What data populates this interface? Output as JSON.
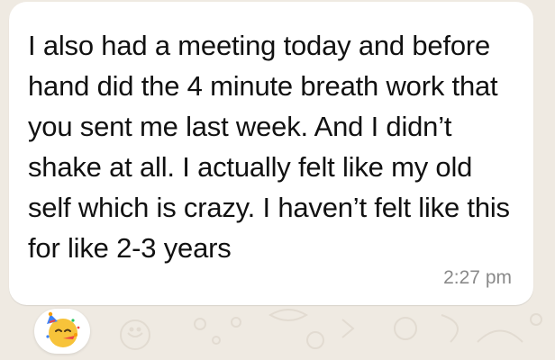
{
  "chat": {
    "message": {
      "text": "I also had a meeting today and before hand did the 4 minute breath work that you sent me last week. And I didn’t shake at all. I actually felt like my old self which is crazy. I haven’t felt like this for like 2-3 years",
      "time": "2:27 pm"
    },
    "reaction": {
      "emoji_name": "partying-face-icon"
    }
  },
  "colors": {
    "background": "#efeae2",
    "bubble": "#ffffff",
    "text": "#111111",
    "timestamp": "#8a8a8a"
  }
}
